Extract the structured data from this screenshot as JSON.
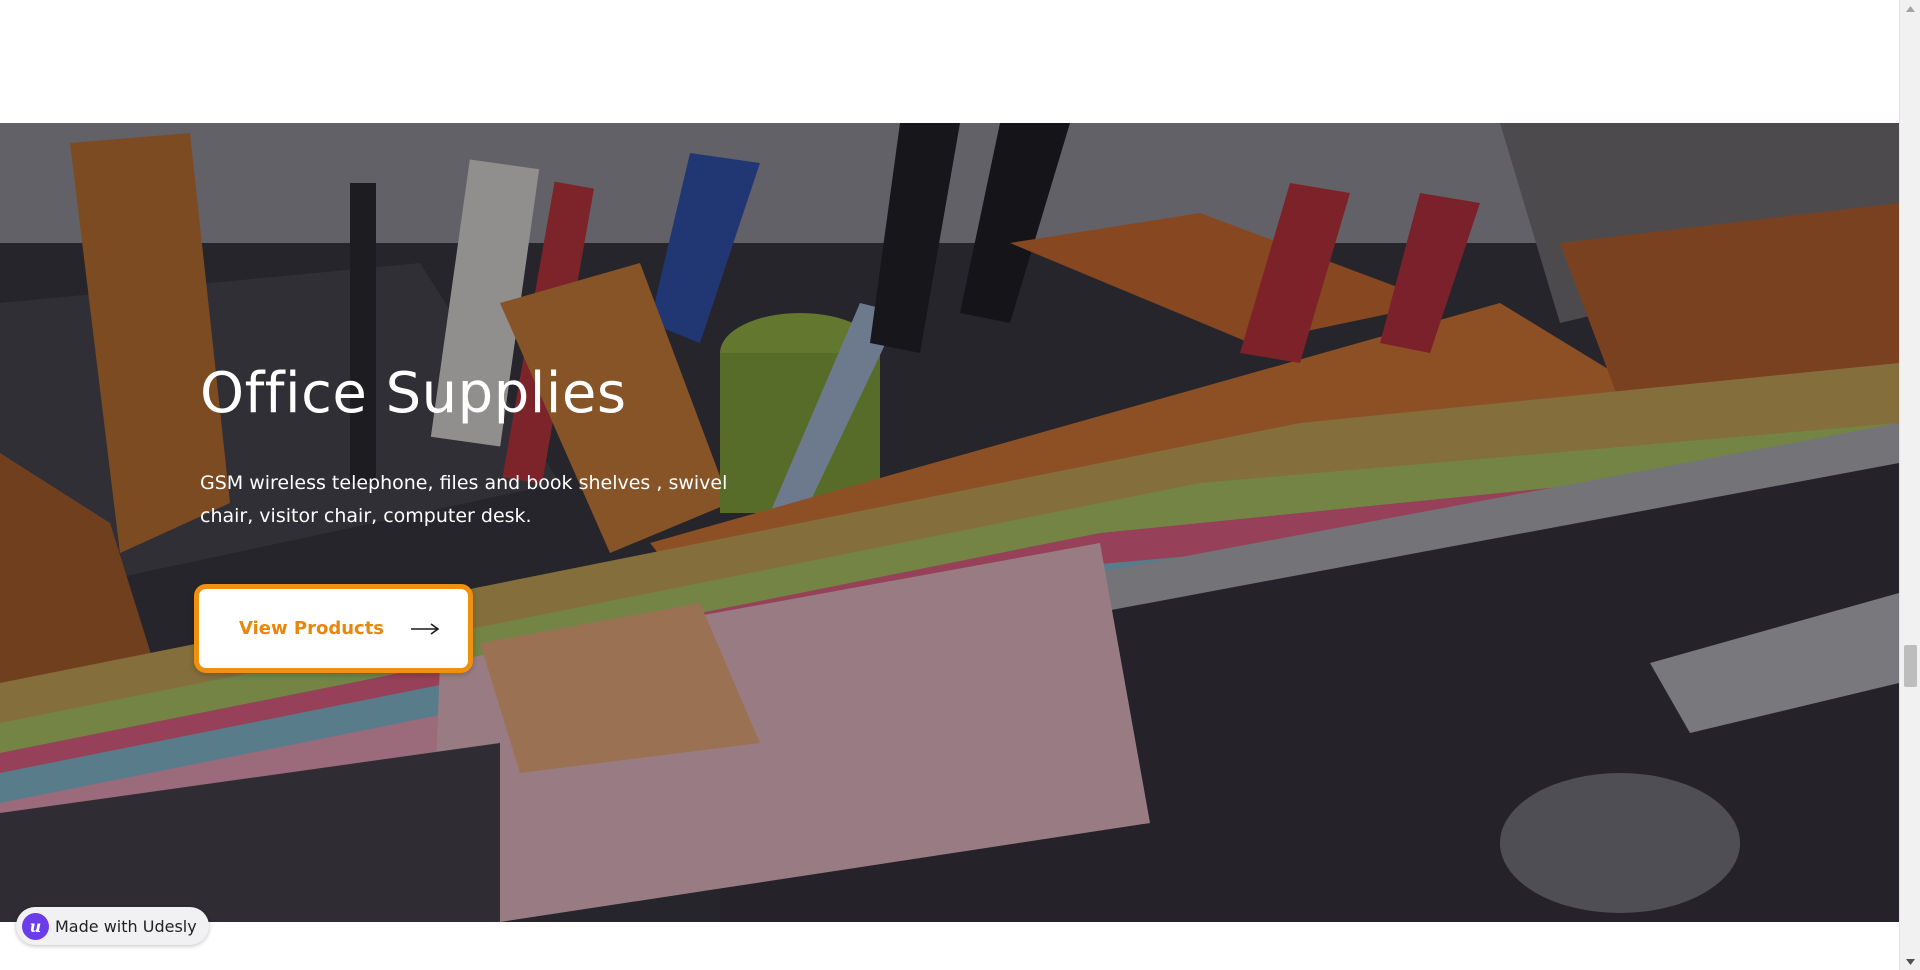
{
  "hero": {
    "title": "Office Supplies",
    "description": "GSM wireless telephone, files and book shelves , swivel chair, visitor chair, computer desk.",
    "cta_label": "View Products",
    "background_image": "office-supplies-photo"
  },
  "badge": {
    "text": "Made with Udesly",
    "logo_letter": "u"
  },
  "colors": {
    "accent": "#f0900f",
    "cta_text": "#e8870a",
    "badge_logo": "#6a3de8"
  },
  "icons": {
    "cta_arrow": "arrow-right-icon",
    "scroll_up": "chevron-up-icon",
    "scroll_down": "chevron-down-icon"
  }
}
